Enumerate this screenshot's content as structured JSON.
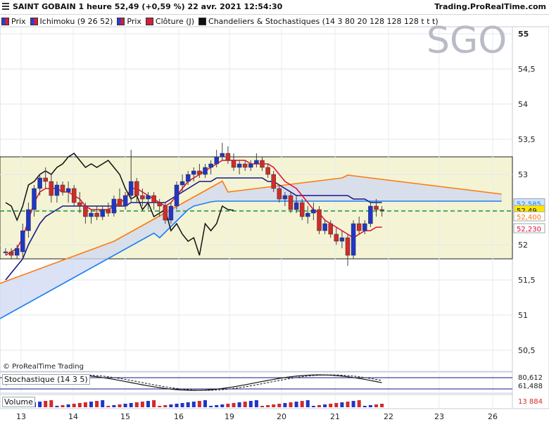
{
  "header": {
    "title": "SAINT GOBAIN 1 heure 52,49 (+0,59 %) 22 avr. 2021 12:54:30",
    "site": "Trading.ProRealTime.com"
  },
  "legend": {
    "items": [
      {
        "label": "Prix",
        "color": "#2e3dd0"
      },
      {
        "label": "Ichimoku (9 26 52)",
        "color": "#d01f3c"
      },
      {
        "label": "Prix",
        "color": "#2e3dd0"
      },
      {
        "label": "Clôture (J)",
        "color": "#d01f3c"
      },
      {
        "label": "Chandeliers & Stochastiques (14 3 80 20 128 128 128 t t t)",
        "color": "#111111"
      }
    ]
  },
  "watermark": "SGO",
  "copyright": "© ProRealTime Trading",
  "stoch_label": "Stochastique (14 3 5)",
  "stoch_values": [
    "80,612",
    "61,488"
  ],
  "volume_label": "Volume",
  "volume_value": "13 884",
  "price_tags": [
    "52,585",
    "52,49",
    "52,400",
    "52,230"
  ],
  "colors": {
    "up": "#2035c8",
    "down": "#d12b2b",
    "tenkan": "#e0103a",
    "kijun": "#16168a",
    "chikou": "#111111",
    "spanA": "#ff7a10",
    "spanB": "#1e7ff0",
    "cloud": "#cfd8f2",
    "band": "#f4f4d4",
    "close": "#1a9a1a"
  },
  "chart_data": {
    "type": "candlestick",
    "x_ticks": [
      "13",
      "14",
      "15",
      "16",
      "19",
      "20",
      "21",
      "22",
      "23",
      "26"
    ],
    "y_ticks": [
      "55",
      "54,5",
      "54",
      "53,5",
      "53",
      "52,5",
      "52",
      "51,5",
      "51",
      "50,5"
    ],
    "ylim": [
      50.2,
      55.1
    ],
    "band": [
      51.8,
      53.25
    ],
    "previous_close": 52.48,
    "candles": [
      [
        51.9,
        51.95,
        51.85,
        51.9
      ],
      [
        51.9,
        51.95,
        51.8,
        51.85
      ],
      [
        51.85,
        52.0,
        51.8,
        51.95
      ],
      [
        51.9,
        52.3,
        51.8,
        52.2
      ],
      [
        52.2,
        52.6,
        52.1,
        52.5
      ],
      [
        52.5,
        52.85,
        52.4,
        52.8
      ],
      [
        52.8,
        53.0,
        52.7,
        52.95
      ],
      [
        52.95,
        53.1,
        52.8,
        52.9
      ],
      [
        52.9,
        53.0,
        52.6,
        52.7
      ],
      [
        52.7,
        52.9,
        52.6,
        52.85
      ],
      [
        52.85,
        52.9,
        52.7,
        52.75
      ],
      [
        52.75,
        52.9,
        52.6,
        52.8
      ],
      [
        52.8,
        52.85,
        52.55,
        52.6
      ],
      [
        52.6,
        52.75,
        52.45,
        52.55
      ],
      [
        52.55,
        52.6,
        52.3,
        52.4
      ],
      [
        52.4,
        52.5,
        52.3,
        52.45
      ],
      [
        52.45,
        52.55,
        52.35,
        52.4
      ],
      [
        52.4,
        52.55,
        52.35,
        52.5
      ],
      [
        52.5,
        52.6,
        52.4,
        52.45
      ],
      [
        52.45,
        52.7,
        52.4,
        52.65
      ],
      [
        52.65,
        52.8,
        52.55,
        52.55
      ],
      [
        52.55,
        52.75,
        52.5,
        52.7
      ],
      [
        52.7,
        53.35,
        52.6,
        52.9
      ],
      [
        52.9,
        52.95,
        52.6,
        52.7
      ],
      [
        52.7,
        52.8,
        52.55,
        52.65
      ],
      [
        52.65,
        52.75,
        52.5,
        52.7
      ],
      [
        52.7,
        52.75,
        52.5,
        52.6
      ],
      [
        52.6,
        52.65,
        52.4,
        52.55
      ],
      [
        52.55,
        52.6,
        52.3,
        52.35
      ],
      [
        52.35,
        52.6,
        52.3,
        52.55
      ],
      [
        52.55,
        52.9,
        52.5,
        52.85
      ],
      [
        52.85,
        53.0,
        52.75,
        52.9
      ],
      [
        52.9,
        53.05,
        52.85,
        53.0
      ],
      [
        53.0,
        53.1,
        52.9,
        53.05
      ],
      [
        53.05,
        53.15,
        52.95,
        53.0
      ],
      [
        53.0,
        53.15,
        52.95,
        53.1
      ],
      [
        53.1,
        53.2,
        53.0,
        53.15
      ],
      [
        53.15,
        53.35,
        53.1,
        53.25
      ],
      [
        53.25,
        53.45,
        53.2,
        53.3
      ],
      [
        53.3,
        53.4,
        53.15,
        53.2
      ],
      [
        53.2,
        53.3,
        53.05,
        53.1
      ],
      [
        53.1,
        53.2,
        53.0,
        53.15
      ],
      [
        53.15,
        53.2,
        53.05,
        53.1
      ],
      [
        53.1,
        53.2,
        53.05,
        53.15
      ],
      [
        53.15,
        53.3,
        53.1,
        53.2
      ],
      [
        53.2,
        53.25,
        53.05,
        53.1
      ],
      [
        53.1,
        53.15,
        52.95,
        53.0
      ],
      [
        53.0,
        53.05,
        52.75,
        52.8
      ],
      [
        52.8,
        52.85,
        52.6,
        52.65
      ],
      [
        52.65,
        52.75,
        52.55,
        52.7
      ],
      [
        52.7,
        52.75,
        52.45,
        52.5
      ],
      [
        52.5,
        52.7,
        52.45,
        52.6
      ],
      [
        52.6,
        52.65,
        52.35,
        52.4
      ],
      [
        52.4,
        52.55,
        52.3,
        52.45
      ],
      [
        52.45,
        52.6,
        52.35,
        52.5
      ],
      [
        52.5,
        52.55,
        52.15,
        52.2
      ],
      [
        52.2,
        52.35,
        52.15,
        52.3
      ],
      [
        52.3,
        52.35,
        52.1,
        52.15
      ],
      [
        52.15,
        52.25,
        52.0,
        52.05
      ],
      [
        52.05,
        52.2,
        51.95,
        52.1
      ],
      [
        52.1,
        52.15,
        51.7,
        51.85
      ],
      [
        51.85,
        52.35,
        51.8,
        52.3
      ],
      [
        52.3,
        52.4,
        52.15,
        52.2
      ],
      [
        52.2,
        52.35,
        52.15,
        52.3
      ],
      [
        52.3,
        52.6,
        52.25,
        52.55
      ],
      [
        52.55,
        52.65,
        52.4,
        52.5
      ],
      [
        52.5,
        52.55,
        52.4,
        52.49
      ]
    ],
    "tenkan": [
      51.85,
      51.9,
      51.95,
      52.1,
      52.35,
      52.6,
      52.75,
      52.8,
      52.8,
      52.8,
      52.75,
      52.75,
      52.7,
      52.65,
      52.55,
      52.5,
      52.5,
      52.5,
      52.5,
      52.55,
      52.6,
      52.65,
      52.8,
      52.8,
      52.75,
      52.7,
      52.65,
      52.6,
      52.55,
      52.6,
      52.7,
      52.8,
      52.9,
      52.95,
      53.0,
      53.05,
      53.1,
      53.15,
      53.2,
      53.2,
      53.2,
      53.2,
      53.2,
      53.15,
      53.15,
      53.15,
      53.15,
      53.1,
      53.0,
      52.9,
      52.85,
      52.8,
      52.7,
      52.6,
      52.5,
      52.45,
      52.35,
      52.3,
      52.25,
      52.2,
      52.15,
      52.1,
      52.15,
      52.2,
      52.2,
      52.25,
      52.25
    ],
    "kijun": [
      51.5,
      51.6,
      51.7,
      51.8,
      52.0,
      52.15,
      52.3,
      52.4,
      52.45,
      52.5,
      52.55,
      52.55,
      52.55,
      52.55,
      52.55,
      52.55,
      52.55,
      52.55,
      52.55,
      52.55,
      52.55,
      52.55,
      52.6,
      52.6,
      52.6,
      52.6,
      52.6,
      52.6,
      52.6,
      52.65,
      52.7,
      52.75,
      52.8,
      52.85,
      52.9,
      52.9,
      52.9,
      52.95,
      52.95,
      52.95,
      52.95,
      52.95,
      52.95,
      52.95,
      52.95,
      52.95,
      52.9,
      52.9,
      52.85,
      52.8,
      52.75,
      52.7,
      52.7,
      52.7,
      52.7,
      52.7,
      52.7,
      52.7,
      52.7,
      52.7,
      52.7,
      52.65,
      52.65,
      52.65,
      52.6,
      52.6,
      52.6
    ]
  }
}
